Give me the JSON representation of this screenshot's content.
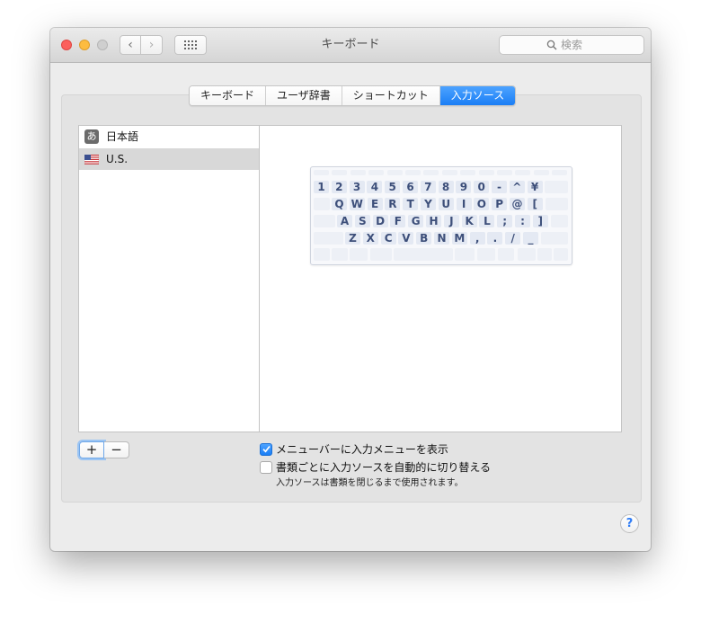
{
  "window": {
    "title": "キーボード"
  },
  "search": {
    "placeholder": "検索"
  },
  "tabs": [
    {
      "label": "キーボード",
      "active": false
    },
    {
      "label": "ユーザ辞書",
      "active": false
    },
    {
      "label": "ショートカット",
      "active": false
    },
    {
      "label": "入力ソース",
      "active": true
    }
  ],
  "sources": [
    {
      "label": "日本語",
      "icon": "hiragana-a-icon",
      "icon_glyph": "あ",
      "selected": false
    },
    {
      "label": "U.S.",
      "icon": "us-flag-icon",
      "selected": true
    }
  ],
  "keyboard": {
    "rows": [
      [
        "1",
        "2",
        "3",
        "4",
        "5",
        "6",
        "7",
        "8",
        "9",
        "0",
        "-",
        "^",
        "¥"
      ],
      [
        "Q",
        "W",
        "E",
        "R",
        "T",
        "Y",
        "U",
        "I",
        "O",
        "P",
        "@",
        "["
      ],
      [
        "A",
        "S",
        "D",
        "F",
        "G",
        "H",
        "J",
        "K",
        "L",
        ";",
        ":",
        "]"
      ],
      [
        "Z",
        "X",
        "C",
        "V",
        "B",
        "N",
        "M",
        ",",
        ".",
        "/",
        "_"
      ]
    ]
  },
  "buttons": {
    "add": "+",
    "remove": "−",
    "help": "?"
  },
  "options": {
    "show_menu": {
      "label": "メニューバーに入力メニューを表示",
      "checked": true
    },
    "auto_switch": {
      "label": "書類ごとに入力ソースを自動的に切り替える",
      "checked": false
    },
    "note": "入力ソースは書類を閉じるまで使用されます。"
  },
  "colors": {
    "accent": "#1a7ef5",
    "close": "#fc605c",
    "minimize": "#fdbc40",
    "zoom_disabled": "#cfcfcf",
    "key_text": "#3d4f7a"
  }
}
